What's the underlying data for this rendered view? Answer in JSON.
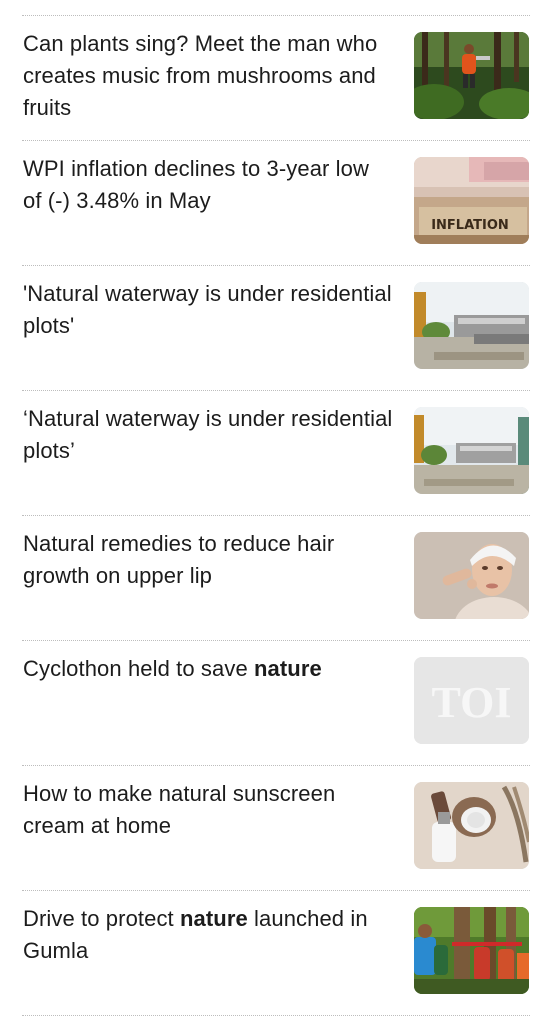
{
  "articles": [
    {
      "title_parts": [
        "Can plants sing? Meet the man who creates music from mushrooms and fruits"
      ],
      "highlight": "",
      "thumbnail_icon": "forest-man-image"
    },
    {
      "title_parts": [
        "WPI inflation declines to 3-year low of (-) 3.48% in May"
      ],
      "highlight": "",
      "thumbnail_icon": "inflation-sign-image",
      "thumbnail_text": "INFLATION"
    },
    {
      "title_parts": [
        "'Natural waterway is under residential plots'"
      ],
      "highlight": "",
      "thumbnail_icon": "construction-site-image"
    },
    {
      "title_parts": [
        "‘Natural waterway is under residential plots’"
      ],
      "highlight": "",
      "thumbnail_icon": "construction-site-image"
    },
    {
      "title_parts": [
        "Natural remedies to reduce hair growth on upper lip"
      ],
      "highlight": "",
      "thumbnail_icon": "woman-portrait-image"
    },
    {
      "title_before": "Cyclothon held to save ",
      "title_bold": "nature",
      "title_after": "",
      "thumbnail_icon": "toi-placeholder-image",
      "thumbnail_text": "TOI"
    },
    {
      "title_parts": [
        "How to make natural sunscreen cream at home"
      ],
      "highlight": "",
      "thumbnail_icon": "sunscreen-bottles-image"
    },
    {
      "title_before": "Drive to protect ",
      "title_bold": "nature",
      "title_after": " launched in Gumla",
      "thumbnail_icon": "tree-hugging-group-image"
    }
  ],
  "colors": {
    "text": "#1c1c1c",
    "separator": "#bdbdbd",
    "placeholder_bg": "#e6e6e6"
  }
}
